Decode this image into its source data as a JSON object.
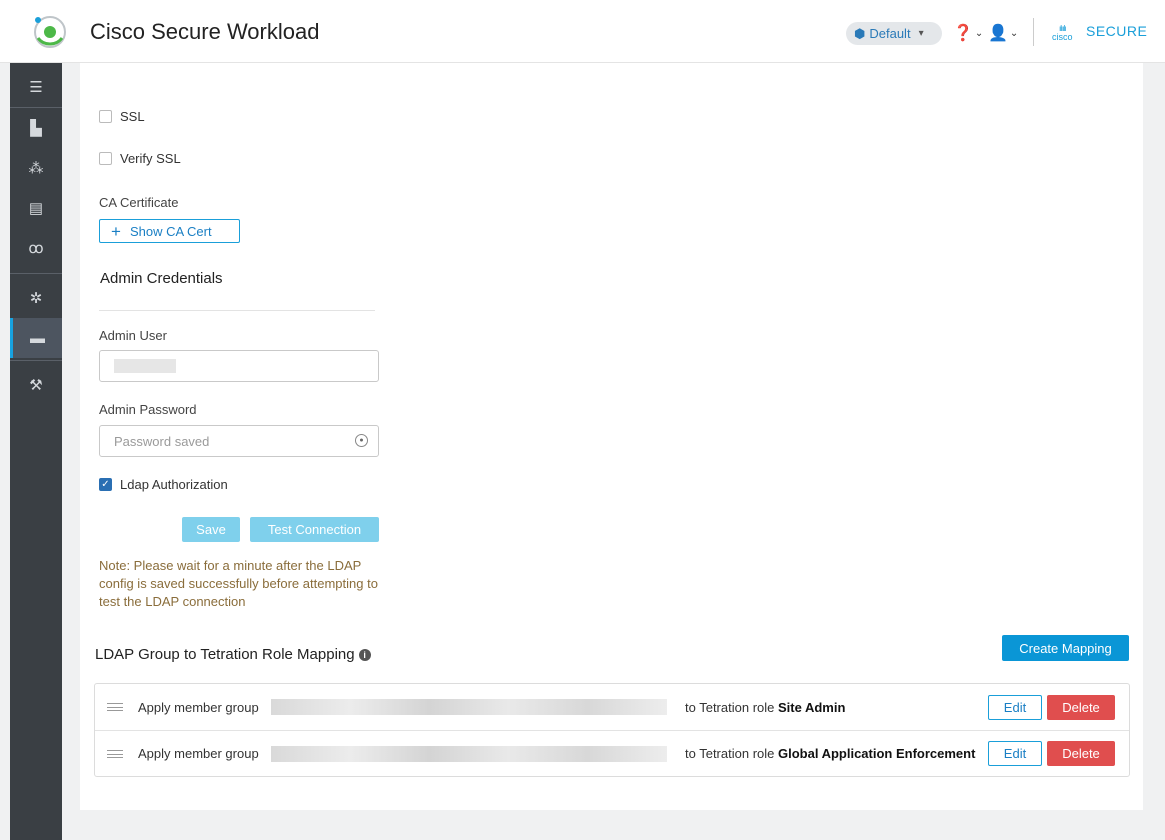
{
  "header": {
    "app_title": "Cisco Secure Workload",
    "scope": "Default",
    "brand": "SECURE",
    "cisco_wordmark": "cisco"
  },
  "sidebar": {
    "items": [
      {
        "icon": "menu-icon"
      },
      {
        "icon": "dashboard-chart-icon"
      },
      {
        "icon": "topology-icon"
      },
      {
        "icon": "policy-shield-icon"
      },
      {
        "icon": "binoculars-icon"
      },
      {
        "icon": "settings-gear-icon"
      },
      {
        "icon": "platform-icon",
        "active": true
      },
      {
        "icon": "tools-icon"
      }
    ],
    "accent_color": "#17a2e0"
  },
  "form": {
    "ssl_label": "SSL",
    "ssl_checked": false,
    "verify_ssl_label": "Verify SSL",
    "verify_ssl_checked": false,
    "ca_cert_label": "CA Certificate",
    "show_ca_cert_label": "Show CA Cert",
    "admin_credentials_title": "Admin Credentials",
    "admin_user_label": "Admin User",
    "admin_password_label": "Admin Password",
    "admin_password_placeholder": "Password saved",
    "ldap_authorization_label": "Ldap Authorization",
    "ldap_authorization_checked": true,
    "save_label": "Save",
    "test_connection_label": "Test Connection",
    "note": "Note: Please wait for a minute after the LDAP config is saved successfully before attempting to test the LDAP connection"
  },
  "mapping": {
    "title": "LDAP Group to Tetration Role Mapping",
    "create_label": "Create Mapping",
    "rows": [
      {
        "prefix": "Apply member group",
        "role_prefix": "to Tetration role",
        "role": "Site Admin",
        "edit_label": "Edit",
        "delete_label": "Delete"
      },
      {
        "prefix": "Apply member group",
        "role_prefix": "to Tetration role",
        "role": "Global Application Enforcement",
        "edit_label": "Edit",
        "delete_label": "Delete"
      }
    ]
  },
  "colors": {
    "primary": "#0a96d6",
    "danger": "#e04e4e",
    "note": "#8a6d3b"
  }
}
